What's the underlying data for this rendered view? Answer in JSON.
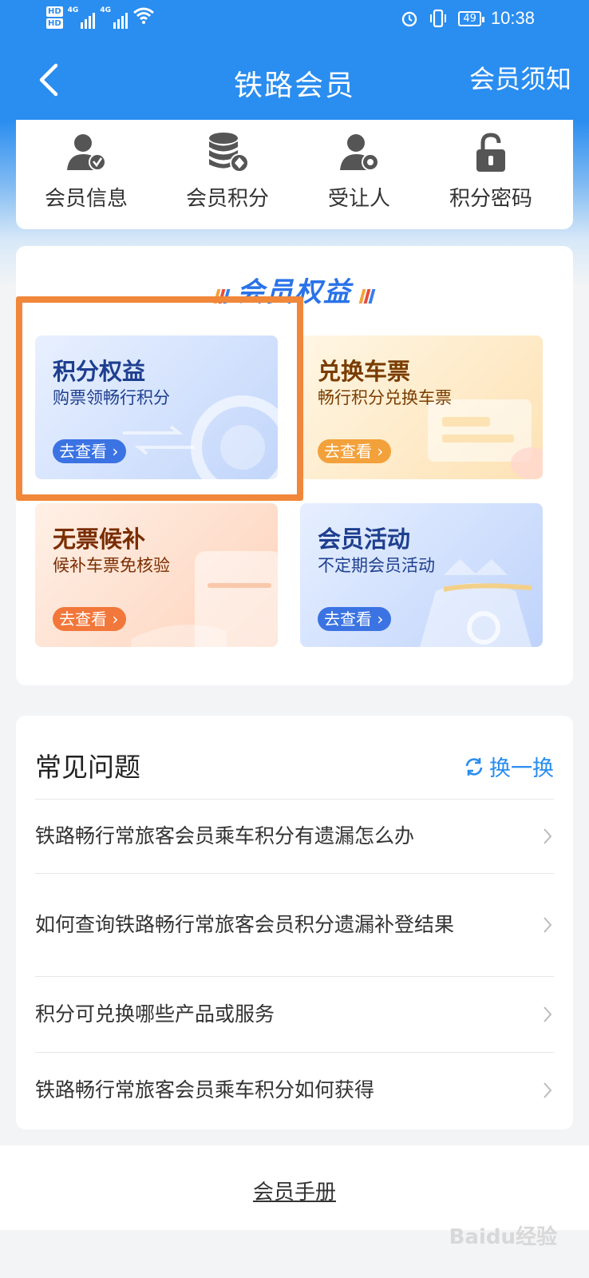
{
  "status_bar": {
    "hd1": "HD",
    "hd2": "HD",
    "net1": "4G",
    "net2": "4G",
    "battery": "49",
    "time": "10:38"
  },
  "header": {
    "title": "铁路会员",
    "right_action": "会员须知"
  },
  "quick_menu": [
    {
      "label": "会员信息",
      "icon": "member-info-icon"
    },
    {
      "label": "会员积分",
      "icon": "points-database-icon"
    },
    {
      "label": "受让人",
      "icon": "assignee-icon"
    },
    {
      "label": "积分密码",
      "icon": "lock-icon"
    }
  ],
  "benefits": {
    "title": "会员权益",
    "tiles": [
      {
        "title": "积分权益",
        "subtitle": "购票领畅行积分",
        "button": "去查看"
      },
      {
        "title": "兑换车票",
        "subtitle": "畅行积分兑换车票",
        "button": "去查看"
      },
      {
        "title": "无票候补",
        "subtitle": "候补车票免核验",
        "button": "去查看"
      },
      {
        "title": "会员活动",
        "subtitle": "不定期会员活动",
        "button": "去查看"
      }
    ]
  },
  "faq": {
    "title": "常见问题",
    "refresh_label": "换一换",
    "items": [
      "铁路畅行常旅客会员乘车积分有遗漏怎么办",
      "如何查询铁路畅行常旅客会员积分遗漏补登结果",
      "积分可兑换哪些产品或服务",
      "铁路畅行常旅客会员乘车积分如何获得"
    ]
  },
  "footer": {
    "link": "会员手册"
  },
  "watermark": "Baidu经验",
  "colors": {
    "primary": "#2a8df0",
    "highlight": "#f0873a"
  }
}
